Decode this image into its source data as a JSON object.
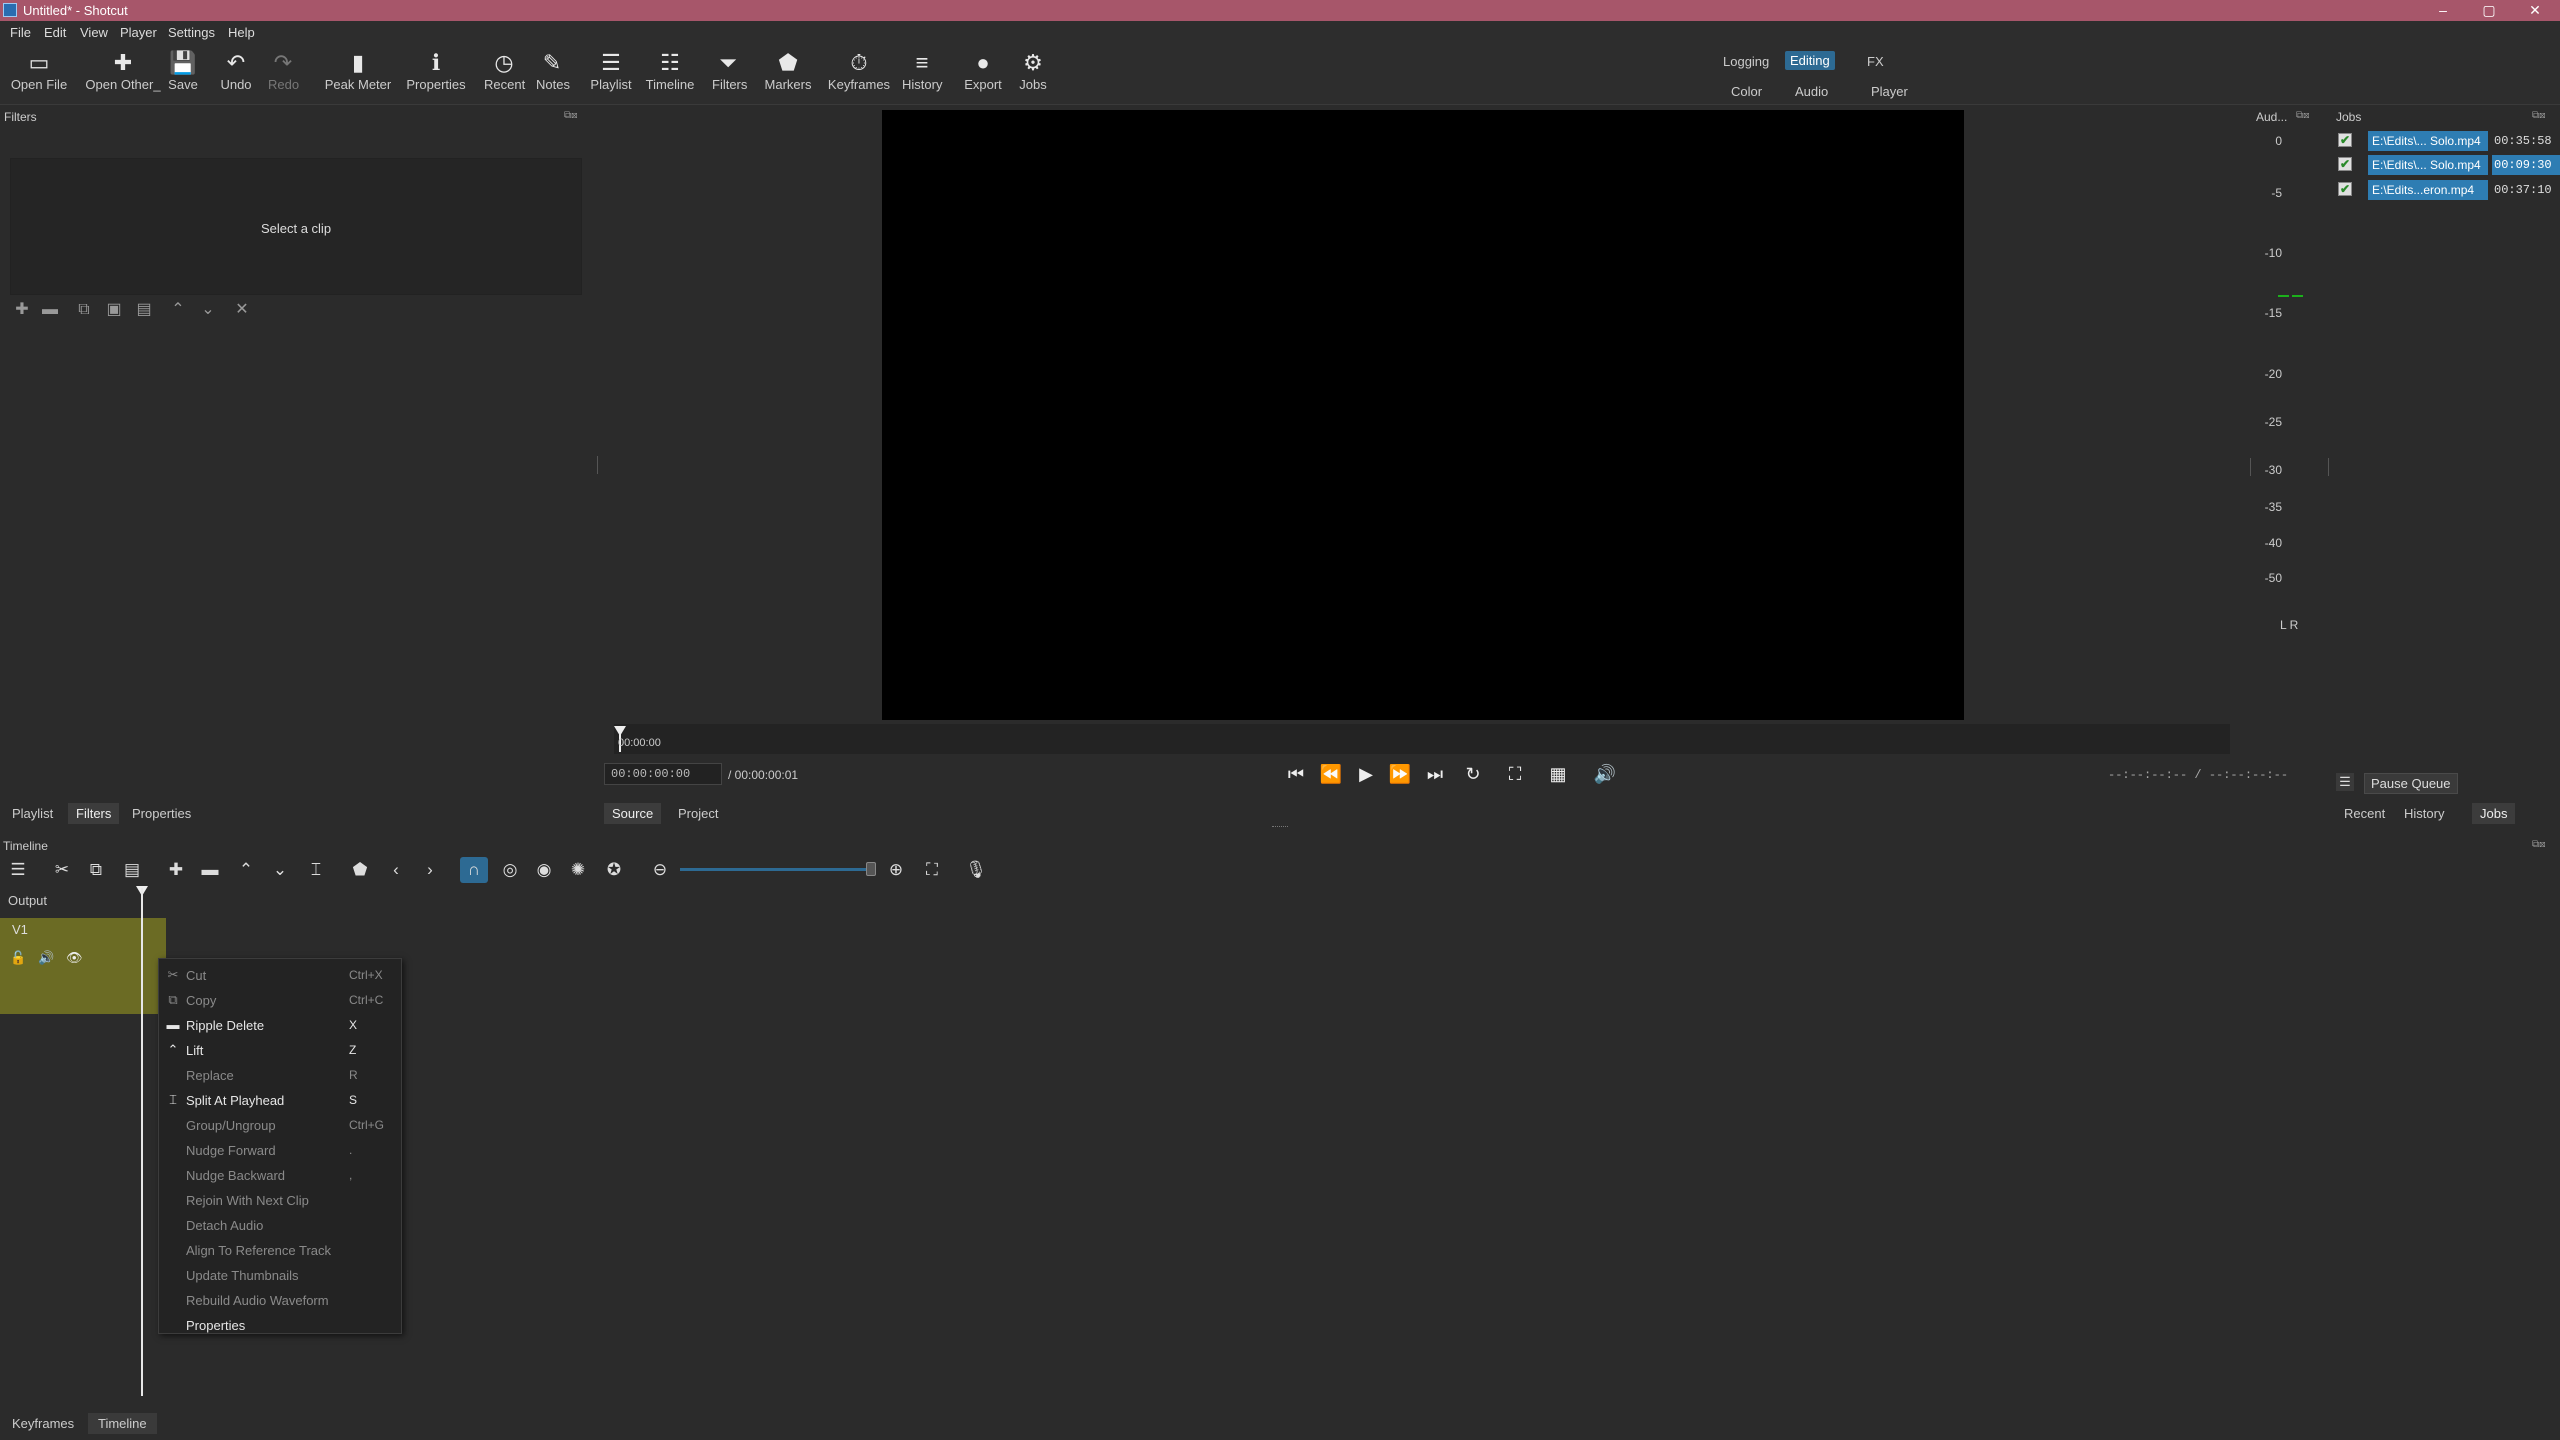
{
  "window": {
    "title": "Untitled* - Shotcut",
    "minimize": "–",
    "maximize": "▢",
    "close": "✕"
  },
  "menu": [
    "File",
    "Edit",
    "View",
    "Player",
    "Settings",
    "Help"
  ],
  "toolbar": [
    {
      "label": "Open File",
      "icon": "folder-icon",
      "glyph": "▭"
    },
    {
      "label": "Open Other_",
      "icon": "open-other-icon",
      "glyph": "✚"
    },
    {
      "label": "Save",
      "icon": "save-icon",
      "glyph": "💾"
    },
    {
      "label": "Undo",
      "icon": "undo-icon",
      "glyph": "↶"
    },
    {
      "label": "Redo",
      "icon": "redo-icon",
      "glyph": "↷",
      "disabled": true
    },
    {
      "label": "Peak Meter",
      "icon": "peak-meter-icon",
      "glyph": "▮"
    },
    {
      "label": "Properties",
      "icon": "info-icon",
      "glyph": "ℹ"
    },
    {
      "label": "Recent",
      "icon": "clock-icon",
      "glyph": "◷"
    },
    {
      "label": "Notes",
      "icon": "notes-icon",
      "glyph": "✎"
    },
    {
      "label": "Playlist",
      "icon": "list-icon",
      "glyph": "☰"
    },
    {
      "label": "Timeline",
      "icon": "timeline-icon",
      "glyph": "☷"
    },
    {
      "label": "Filters",
      "icon": "filter-icon",
      "glyph": "⏷"
    },
    {
      "label": "Markers",
      "icon": "marker-icon",
      "glyph": "⬟"
    },
    {
      "label": "Keyframes",
      "icon": "stopwatch-icon",
      "glyph": "⏱"
    },
    {
      "label": "History",
      "icon": "history-icon",
      "glyph": "≡"
    },
    {
      "label": "Export",
      "icon": "export-icon",
      "glyph": "●"
    },
    {
      "label": "Jobs",
      "icon": "gear-icon",
      "glyph": "⚙"
    }
  ],
  "layouts": {
    "logging": "Logging",
    "editing": "Editing",
    "fx": "FX",
    "color": "Color",
    "audio": "Audio",
    "player": "Player"
  },
  "filters": {
    "title": "Filters",
    "empty": "Select a clip"
  },
  "player": {
    "scrub_time": "00:00:00",
    "position": "00:00:00:00",
    "duration": "/ 00:00:00:01",
    "in_out": "--:--:--:-- / --:--:--:--",
    "source_tab": "Source",
    "project_tab": "Project"
  },
  "left_tabs": [
    "Playlist",
    "Filters",
    "Properties"
  ],
  "audio": {
    "title": "Aud...",
    "scale": [
      "0",
      "-5",
      "-10",
      "-15",
      "-20",
      "-25",
      "-30",
      "-35",
      "-40",
      "-50"
    ],
    "lr": "L R"
  },
  "jobs": {
    "title": "Jobs",
    "items": [
      {
        "name": "E:\\Edits\\... Solo.mp4",
        "time": "00:35:58",
        "time_hl": false
      },
      {
        "name": "E:\\Edits\\... Solo.mp4",
        "time": "00:09:30",
        "time_hl": true
      },
      {
        "name": "E:\\Edits...eron.mp4",
        "time": "00:37:10",
        "time_hl": false
      }
    ],
    "pause_queue": "Pause Queue"
  },
  "right_tabs": [
    "Recent",
    "History",
    "Jobs"
  ],
  "timeline": {
    "title": "Timeline",
    "output": "Output",
    "track": "V1"
  },
  "context_menu": [
    {
      "label": "Cut",
      "shortcut": "Ctrl+X",
      "enabled": false,
      "icon": "✂",
      "icon_name": "scissors-icon"
    },
    {
      "label": "Copy",
      "shortcut": "Ctrl+C",
      "enabled": false,
      "icon": "⧉",
      "icon_name": "copy-icon"
    },
    {
      "label": "Ripple Delete",
      "shortcut": "X",
      "enabled": true,
      "icon": "▬",
      "icon_name": "ripple-delete-icon"
    },
    {
      "label": "Lift",
      "shortcut": "Z",
      "enabled": true,
      "icon": "⌃",
      "icon_name": "lift-icon"
    },
    {
      "label": "Replace",
      "shortcut": "R",
      "enabled": false,
      "icon": "",
      "icon_name": ""
    },
    {
      "label": "Split At Playhead",
      "shortcut": "S",
      "enabled": true,
      "icon": "⌶",
      "icon_name": "split-icon"
    },
    {
      "label": "Group/Ungroup",
      "shortcut": "Ctrl+G",
      "enabled": false,
      "icon": "",
      "icon_name": ""
    },
    {
      "label": "Nudge Forward",
      "shortcut": ".",
      "enabled": false,
      "icon": "",
      "icon_name": ""
    },
    {
      "label": "Nudge Backward",
      "shortcut": ",",
      "enabled": false,
      "icon": "",
      "icon_name": ""
    },
    {
      "label": "Rejoin With Next Clip",
      "shortcut": "",
      "enabled": false,
      "icon": "",
      "icon_name": ""
    },
    {
      "label": "Detach Audio",
      "shortcut": "",
      "enabled": false,
      "icon": "",
      "icon_name": ""
    },
    {
      "label": "Align To Reference Track",
      "shortcut": "",
      "enabled": false,
      "icon": "",
      "icon_name": ""
    },
    {
      "label": "Update Thumbnails",
      "shortcut": "",
      "enabled": false,
      "icon": "",
      "icon_name": ""
    },
    {
      "label": "Rebuild Audio Waveform",
      "shortcut": "",
      "enabled": false,
      "icon": "",
      "icon_name": ""
    },
    {
      "label": "Properties",
      "shortcut": "",
      "enabled": true,
      "icon": "",
      "icon_name": ""
    }
  ],
  "bottom_tabs": [
    "Keyframes",
    "Timeline"
  ]
}
